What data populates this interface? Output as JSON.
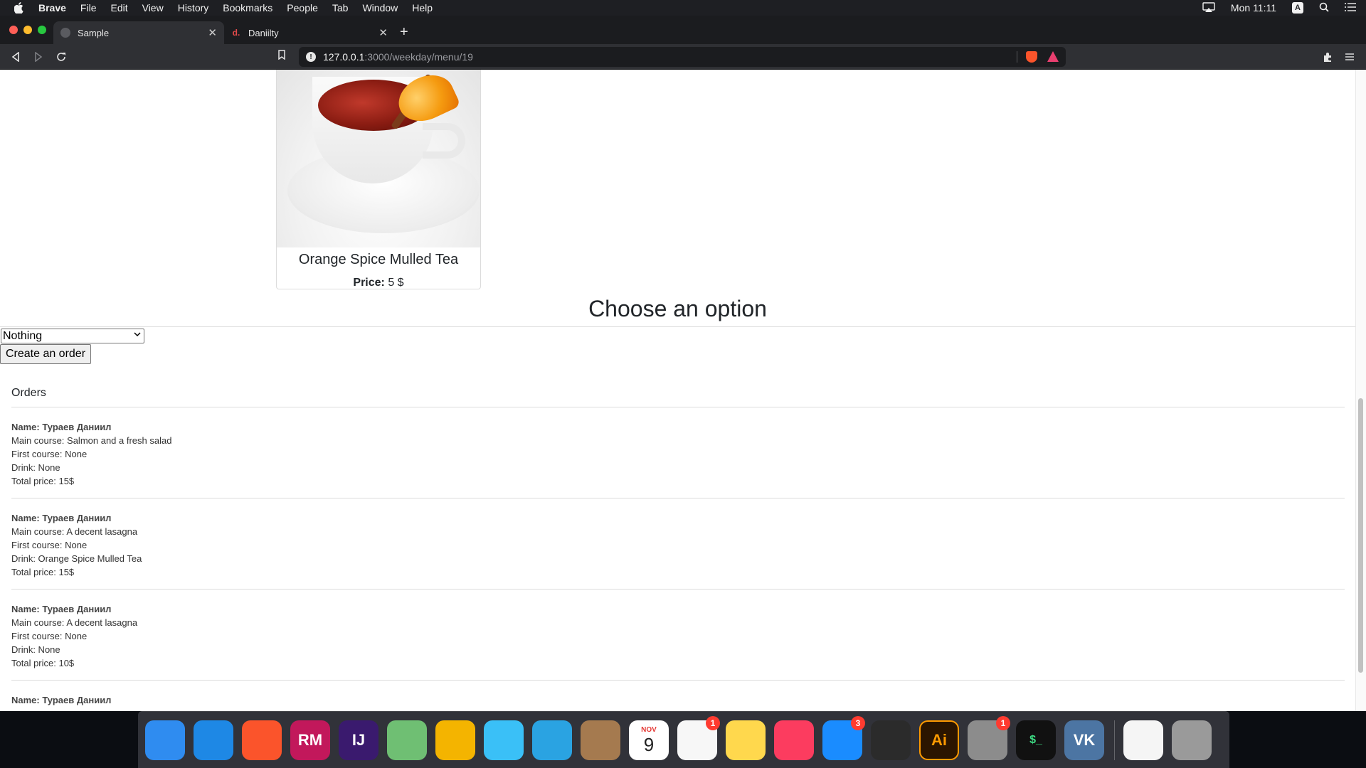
{
  "menubar": {
    "app_name": "Brave",
    "items": [
      "File",
      "Edit",
      "View",
      "History",
      "Bookmarks",
      "People",
      "Tab",
      "Window",
      "Help"
    ],
    "clock": "Mon 11:11",
    "input_source": "A"
  },
  "browser": {
    "tabs": [
      {
        "title": "Sample",
        "active": true
      },
      {
        "title": "Daniilty",
        "active": false,
        "favicon": "d."
      }
    ],
    "url_host": "127.0.0.1",
    "url_path": ":3000/weekday/menu/19"
  },
  "card": {
    "title": "Orange Spice Mulled Tea",
    "price_label": "Price:",
    "price_value": "5 $"
  },
  "form": {
    "heading": "Choose an option",
    "select_value": "Nothing",
    "submit_label": "Create an order"
  },
  "orders": {
    "title": "Orders",
    "items": [
      {
        "name": "Name: Тураев Даниил",
        "main": "Main course: Salmon and a fresh salad",
        "first": "First course: None",
        "drink": "Drink: None",
        "total": "Total price: 15$"
      },
      {
        "name": "Name: Тураев Даниил",
        "main": "Main course: A decent lasagna",
        "first": "First course: None",
        "drink": "Drink: Orange Spice Mulled Tea",
        "total": "Total price: 15$"
      },
      {
        "name": "Name: Тураев Даниил",
        "main": "Main course: A decent lasagna",
        "first": "First course: None",
        "drink": "Drink: None",
        "total": "Total price: 10$"
      },
      {
        "name": "Name: Тураев Даниил"
      }
    ]
  },
  "dock": {
    "apps": [
      {
        "name": "finder-icon",
        "color": "#2f8cf0"
      },
      {
        "name": "safari-icon",
        "color": "#1e88e5"
      },
      {
        "name": "brave-icon",
        "color": "#fb542b"
      },
      {
        "name": "rubymine-icon",
        "color": "#c2185b",
        "label": "RM"
      },
      {
        "name": "intellij-icon",
        "color": "#3a1a6e",
        "label": "IJ"
      },
      {
        "name": "maps-icon",
        "color": "#6fbf73"
      },
      {
        "name": "photos-icon",
        "color": "#f4b400"
      },
      {
        "name": "messages-icon",
        "color": "#3ac0f7"
      },
      {
        "name": "telegram-icon",
        "color": "#2aa3e2"
      },
      {
        "name": "contacts-icon",
        "color": "#a57a4f"
      },
      {
        "name": "calendar-icon",
        "color": "#ffffff",
        "month": "NOV",
        "day": "9"
      },
      {
        "name": "reminders-icon",
        "color": "#f7f7f7",
        "badge": "1"
      },
      {
        "name": "notes-icon",
        "color": "#ffd84d"
      },
      {
        "name": "music-icon",
        "color": "#fc3c5f"
      },
      {
        "name": "app-store-icon",
        "color": "#1a8cff",
        "badge": "3"
      },
      {
        "name": "final-cut-icon",
        "color": "#2b2b2b"
      },
      {
        "name": "illustrator-icon",
        "color": "#2b1500",
        "label": "Ai"
      },
      {
        "name": "system-preferences-icon",
        "color": "#8c8c8c",
        "badge": "1"
      },
      {
        "name": "terminal-icon",
        "color": "#111111",
        "label": "$_"
      },
      {
        "name": "vk-icon",
        "color": "#4c75a3",
        "label": "VK"
      }
    ],
    "extras": [
      {
        "name": "tea-image-icon",
        "color": "#f5f5f5"
      },
      {
        "name": "trash-icon",
        "color": "#9a9a9a"
      }
    ]
  }
}
